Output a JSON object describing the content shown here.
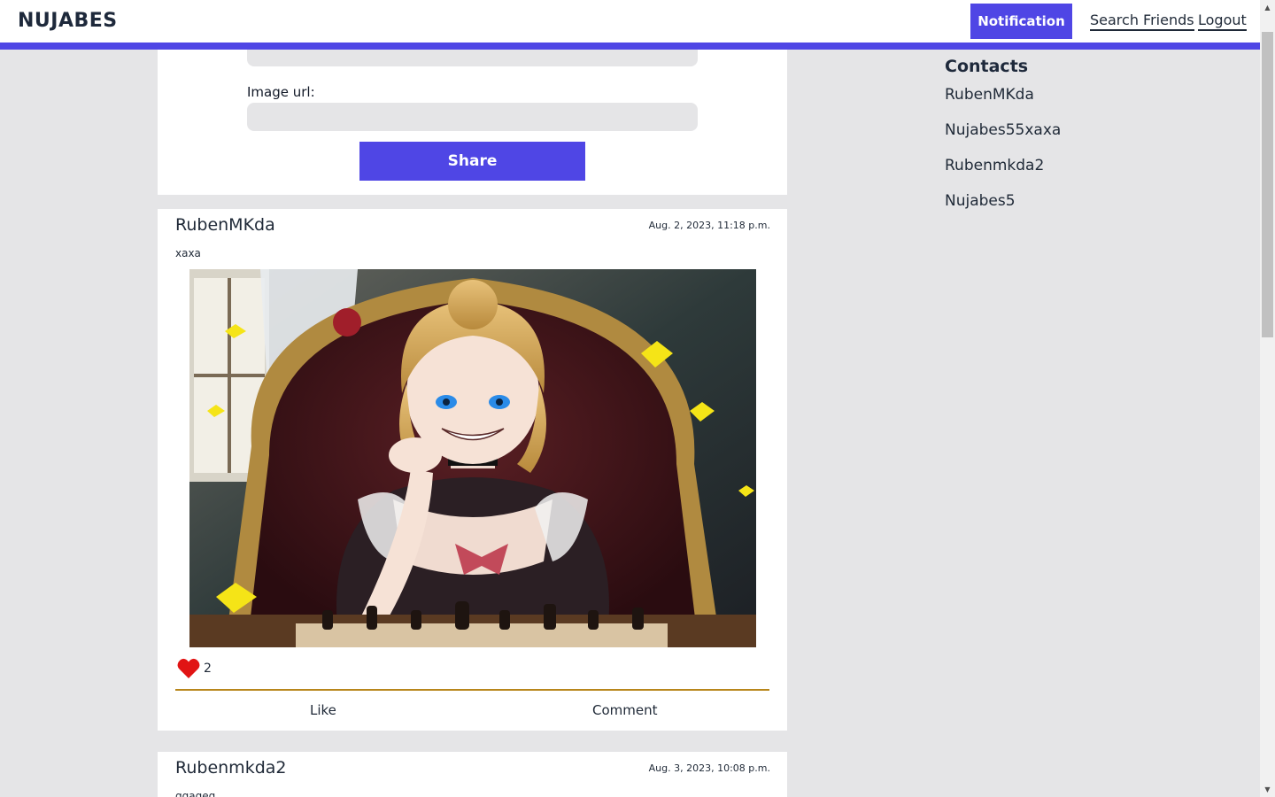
{
  "navbar": {
    "brand": "NUJABES",
    "notification_label": "Notification",
    "search_label": "Search Friends",
    "logout_label": "Logout",
    "accent_color": "#4f46e5"
  },
  "share_form": {
    "top_field_value": "",
    "image_url_label": "Image url:",
    "image_url_value": "",
    "share_label": "Share"
  },
  "posts": [
    {
      "author": "RubenMKda",
      "date": "Aug. 2, 2023, 11:18 p.m.",
      "text": "xaxa",
      "image_description_icon": "anime-girl-chess-image",
      "like_count": "2",
      "like_label": "Like",
      "comment_label": "Comment"
    },
    {
      "author": "Rubenmkda2",
      "date": "Aug. 3, 2023, 10:08 p.m.",
      "text": "qqaqeq"
    }
  ],
  "contacts": {
    "title": "Contacts",
    "items": [
      "RubenMKda",
      "Nujabes55xaxa",
      "Rubenmkda2",
      "Nujabes5"
    ]
  }
}
